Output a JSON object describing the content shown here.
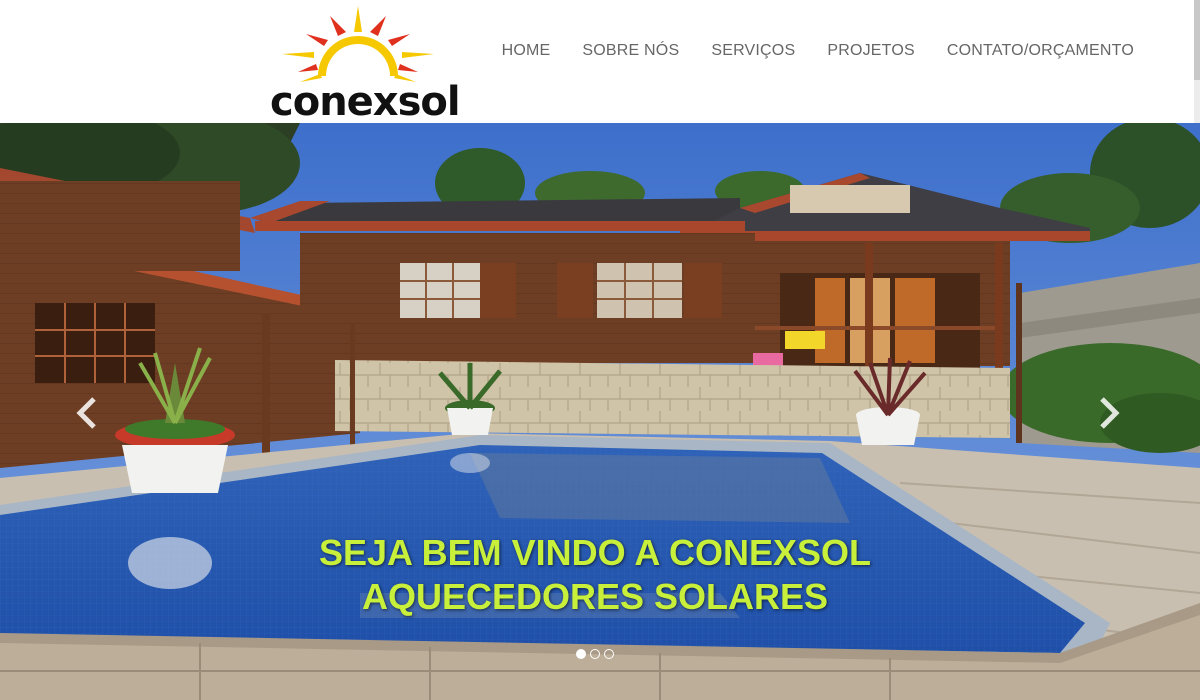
{
  "brand": {
    "name": "conexsol",
    "sun_color": "#f6c800",
    "ray_color": "#e0301e"
  },
  "nav": {
    "items": [
      {
        "label": "HOME"
      },
      {
        "label": "SOBRE NÓS"
      },
      {
        "label": "SERVIÇOS"
      },
      {
        "label": "PROJETOS"
      },
      {
        "label": "CONTATO/ORÇAMENTO"
      }
    ]
  },
  "hero": {
    "caption": "SEJA BEM VINDO A CONEXSOL AQUECEDORES SOLARES",
    "caption_color": "#c8f03a",
    "prev_icon": "chevron-left-icon",
    "next_icon": "chevron-right-icon",
    "slides": {
      "count": 3,
      "active_index": 0
    }
  }
}
